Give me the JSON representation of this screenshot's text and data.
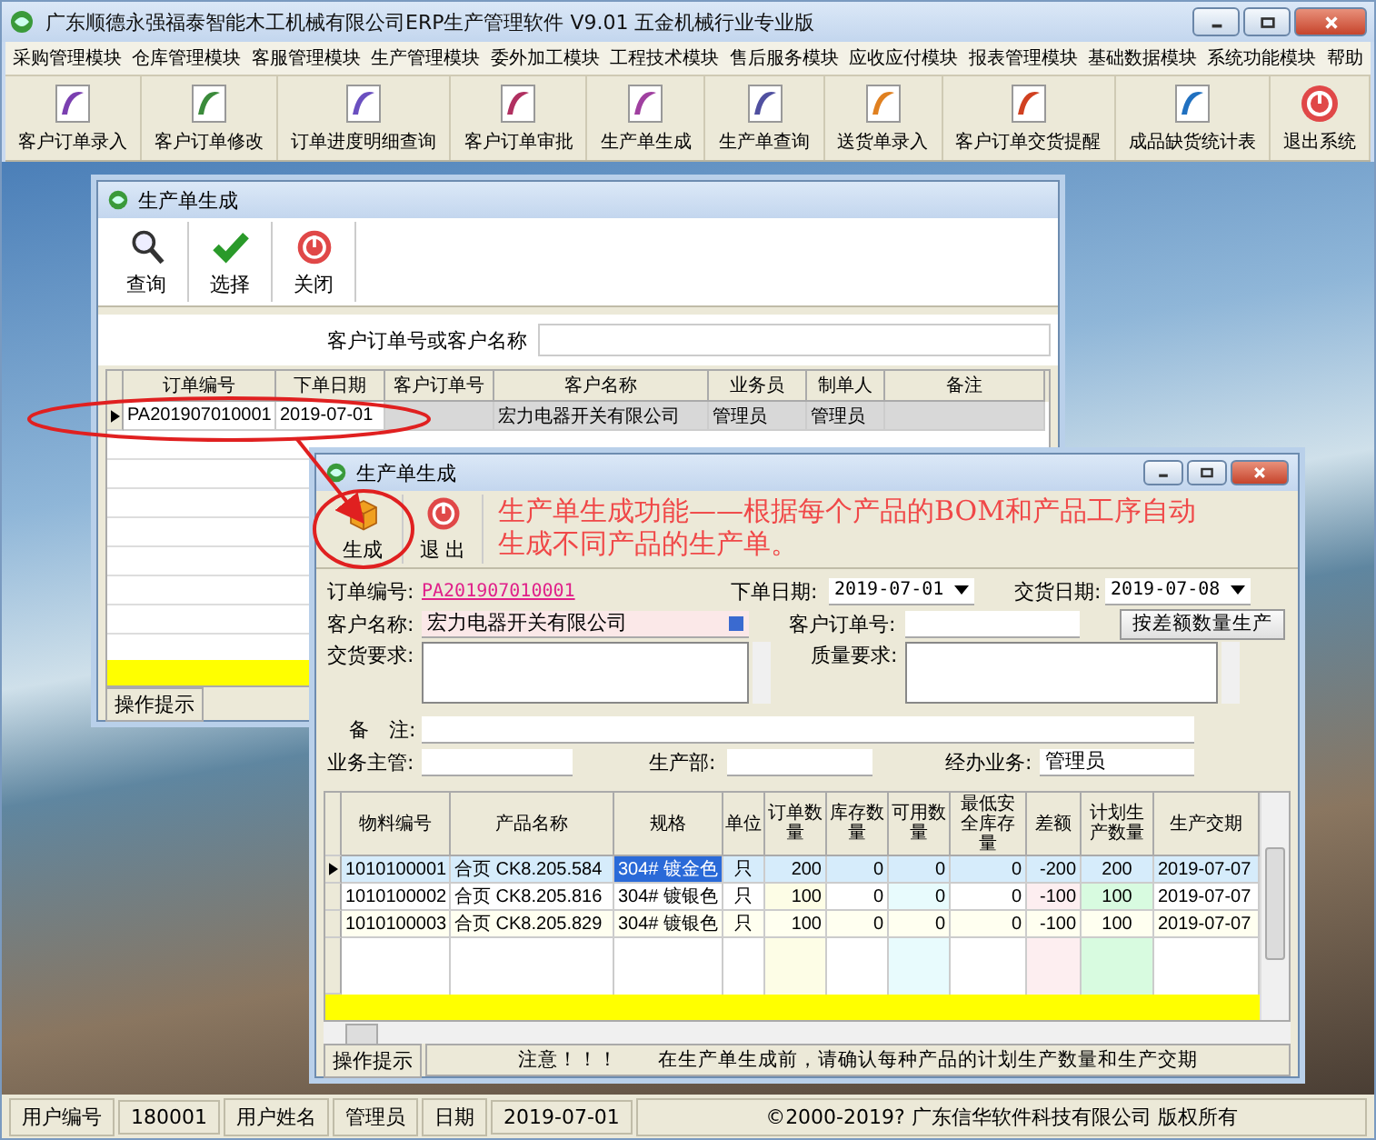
{
  "app": {
    "title": "广东顺德永强福泰智能木工机械有限公司ERP生产管理软件  V9.01 五金机械行业专业版"
  },
  "menu": [
    "采购管理模块",
    "仓库管理模块",
    "客服管理模块",
    "生产管理模块",
    "委外加工模块",
    "工程技术模块",
    "售后服务模块",
    "应收应付模块",
    "报表管理模块",
    "基础数据模块",
    "系统功能模块",
    "帮助"
  ],
  "toolbar": [
    {
      "label": "客户订单录入",
      "kind": "module"
    },
    {
      "label": "客户订单修改",
      "kind": "module"
    },
    {
      "label": "订单进度明细查询",
      "kind": "module"
    },
    {
      "label": "客户订单审批",
      "kind": "module"
    },
    {
      "label": "生产单生成",
      "kind": "module"
    },
    {
      "label": "生产单查询",
      "kind": "module"
    },
    {
      "label": "送货单录入",
      "kind": "module"
    },
    {
      "label": "客户订单交货提醒",
      "kind": "module"
    },
    {
      "label": "成品缺货统计表",
      "kind": "module"
    },
    {
      "label": "退出系统",
      "kind": "exit"
    }
  ],
  "order_window": {
    "title": "生产单生成",
    "tools": [
      {
        "label": "查询",
        "kind": "search"
      },
      {
        "label": "选择",
        "kind": "check"
      },
      {
        "label": "关闭",
        "kind": "power"
      }
    ],
    "search_label": "客户订单号或客户名称",
    "columns": [
      "订单编号",
      "下单日期",
      "客户订单号",
      "客户名称",
      "业务员",
      "制单人",
      "备注"
    ],
    "rows": [
      {
        "cells": [
          "PA201907010001",
          "2019-07-01",
          "",
          "宏力电器开关有限公司",
          "管理员",
          "管理员",
          ""
        ],
        "selected": true
      }
    ],
    "status": "操作提示"
  },
  "production_window": {
    "title": "生产单生成",
    "tools": [
      {
        "label": "生成",
        "kind": "box"
      },
      {
        "label": "退 出",
        "kind": "power"
      }
    ],
    "annotation": "生产单生成功能——根据每个产品的BOM和产品工序自动生成不同产品的生产单。",
    "form": {
      "order_no_label": "订单编号:",
      "order_no": "PA201907010001",
      "order_date_label": "下单日期:",
      "order_date": "2019-07-01",
      "delivery_date_label": "交货日期:",
      "delivery_date": "2019-07-08",
      "customer_label": "客户名称:",
      "customer": "宏力电器开关有限公司",
      "customer_order_label": "客户订单号:",
      "diff_button": "按差额数量生产",
      "delivery_req_label": "交货要求:",
      "quality_req_label": "质量要求:",
      "remark_label": "备　注:",
      "supervisor_label": "业务主管:",
      "department_label": "生产部:",
      "handler_label": "经办业务:",
      "handler": "管理员"
    },
    "columns": [
      "物料编号",
      "产品名称",
      "规格",
      "单位",
      "订单数量",
      "库存数量",
      "可用数量",
      "最低安全库存量",
      "差额",
      "计划生产数量",
      "生产交期"
    ],
    "rows": [
      {
        "cells": [
          "1010100001",
          "合页 CK8.205.584",
          "304# 镀金色",
          "只",
          "200",
          "0",
          "0",
          "0",
          "-200",
          "200",
          "2019-07-07"
        ],
        "selected": true
      },
      {
        "cells": [
          "1010100002",
          "合页 CK8.205.816",
          "304# 镀银色",
          "只",
          "100",
          "0",
          "0",
          "0",
          "-100",
          "100",
          "2019-07-07"
        ],
        "selected": false
      },
      {
        "cells": [
          "1010100003",
          "合页 CK8.205.829",
          "304# 镀银色",
          "只",
          "100",
          "0",
          "0",
          "0",
          "-100",
          "100",
          "2019-07-07"
        ],
        "selected": false
      }
    ],
    "status_label": "操作提示",
    "notice": "注意！！！",
    "notice_text": "在生产单生成前，请确认每种产品的计划生产数量和生产交期"
  },
  "status_bar": [
    "用户编号",
    "180001",
    "用户姓名",
    "管理员",
    "日期",
    "2019-07-01",
    "©2000-2019?  广东信华软件科技有限公司    版权所有"
  ]
}
